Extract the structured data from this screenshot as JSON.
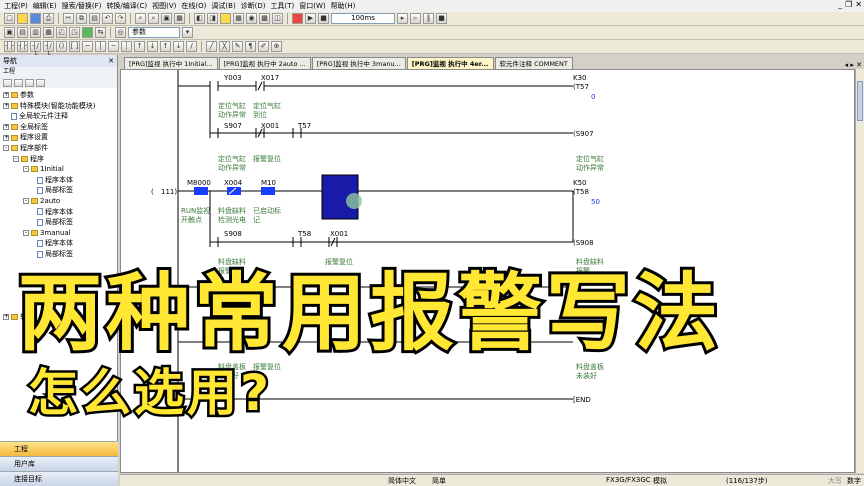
{
  "menu": {
    "items": [
      "工程(P)",
      "编辑(E)",
      "搜索/替换(F)",
      "转换/编译(C)",
      "视图(V)",
      "在线(O)",
      "调试(B)",
      "诊断(D)",
      "工具(T)",
      "窗口(W)",
      "帮助(H)"
    ]
  },
  "toolbar": {
    "scan_time": "100ms",
    "mode_combo": "参数"
  },
  "nav": {
    "title": "导航",
    "subtitle": "工程",
    "tree": [
      {
        "label": "参数",
        "level": 0,
        "expand": "+"
      },
      {
        "label": "特殊模块(智能功能模块)",
        "level": 0,
        "expand": "+"
      },
      {
        "label": "全局软元件注释",
        "level": 0,
        "expand": ""
      },
      {
        "label": "全局标签",
        "level": 0,
        "expand": "+"
      },
      {
        "label": "程序设置",
        "level": 0,
        "expand": "+"
      },
      {
        "label": "程序部件",
        "level": 0,
        "expand": "-"
      },
      {
        "label": "程序",
        "level": 1,
        "expand": "-"
      },
      {
        "label": "1Initial",
        "level": 2,
        "expand": "-"
      },
      {
        "label": "程序本体",
        "level": 3,
        "expand": ""
      },
      {
        "label": "局部标签",
        "level": 3,
        "expand": ""
      },
      {
        "label": "2auto",
        "level": 2,
        "expand": "-"
      },
      {
        "label": "程序本体",
        "level": 3,
        "expand": ""
      },
      {
        "label": "局部标签",
        "level": 3,
        "expand": ""
      },
      {
        "label": "3manual",
        "level": 2,
        "expand": "-"
      },
      {
        "label": "程序本体",
        "level": 3,
        "expand": ""
      },
      {
        "label": "局部标签",
        "level": 3,
        "expand": ""
      }
    ],
    "extra_item": "软",
    "bottom": [
      {
        "label": "工程",
        "active": true
      },
      {
        "label": "用户库",
        "active": false
      },
      {
        "label": "连接目标",
        "active": false
      }
    ]
  },
  "tabs": [
    {
      "label": "[PRG]监视 执行中 1Initial...",
      "active": false
    },
    {
      "label": "[PRG]监视 执行中 2auto ...",
      "active": false
    },
    {
      "label": "[PRG]监视 执行中 3manu...",
      "active": false
    },
    {
      "label": "[PRG]监视 执行中 4er...",
      "active": true
    },
    {
      "label": "软元件注释 COMMENT",
      "active": false
    }
  ],
  "ladder": {
    "contacts": {
      "y003": "Y003",
      "x017a": "X017",
      "s907a": "S907",
      "x001a": "X001",
      "t57": "T57",
      "m8000": "M8000",
      "x004": "X004",
      "m10": "M10",
      "s908a": "S908",
      "t58c": "T58",
      "x001b": "X001"
    },
    "coils": {
      "k30": "K30",
      "t57": "(T57",
      "t57_val": "0",
      "s907": "(S907",
      "k50": "K50",
      "t58": "(T58",
      "t58_val": "50",
      "s908": "(S908",
      "end": "[END"
    },
    "step": "111)",
    "paren": "(",
    "comments": {
      "c1a": "定位气缸",
      "c1b": "动作异常",
      "c2a": "定位气缸",
      "c2b": "到位",
      "c3": "报警复位",
      "c4a": "定位气缸",
      "c4b": "动作异常",
      "c5a": "RUN监视",
      "c5b": "开触点",
      "c6a": "料盘缺料",
      "c6b": "检测光电",
      "c7a": "已启动标",
      "c7b": "记",
      "c8": "报警复位",
      "c9a": "料盘缺料",
      "c9b": "报警",
      "c10a": "料盘缺料",
      "c10b": "报警",
      "c11a": "料盘盖板",
      "c11b": "未装好",
      "c12": "报警复位",
      "c13a": "料盘盖板",
      "c13b": "未装好"
    }
  },
  "status": {
    "lang": "简体中文",
    "mode": "简单",
    "plc": "FX3G/FX3GC",
    "sim": "模拟",
    "steps": "(116/137步)",
    "caps": "大写",
    "num": "数字"
  },
  "overlay": {
    "title": "两种常用报警写法",
    "subtitle": "怎么选用?"
  },
  "colors": {
    "monitor_on": "#1a3cff",
    "overlay_text": "#ffe733",
    "active_tab": "#fff6c8"
  }
}
